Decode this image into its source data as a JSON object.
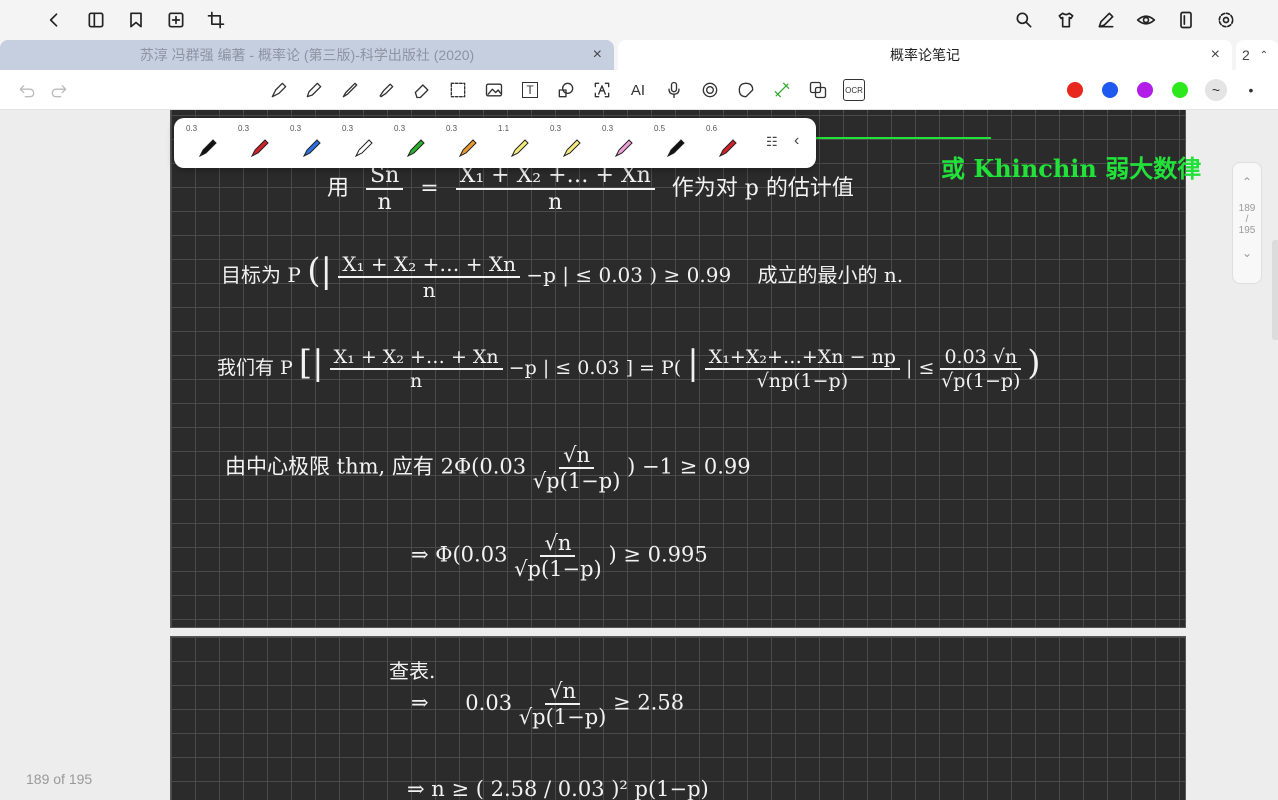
{
  "tabs": {
    "inactive_title": "苏淳 冯群强 编著 - 概率论 (第三版)-科学出版社 (2020)",
    "active_title": "概率论笔记",
    "close": "×",
    "count": "2"
  },
  "topbar_icons": [
    "back-icon",
    "sidebar-icon",
    "bookmark-icon",
    "add-page-icon",
    "crop-icon",
    "search-icon",
    "shirt-icon",
    "pen-edit-icon",
    "eye-icon",
    "page-layout-icon",
    "gear-icon"
  ],
  "toolbar": {
    "text_tool": "T",
    "ai_tool": "AI",
    "ocr_tool": "OCR",
    "more": "•",
    "colors": [
      "#e8281e",
      "#1e5af0",
      "#b21ee8",
      "#2ee81e"
    ]
  },
  "pen_presets": [
    {
      "size": "0.3",
      "color": "#111111"
    },
    {
      "size": "0.3",
      "color": "#d0202a"
    },
    {
      "size": "0.3",
      "color": "#2a6ee0"
    },
    {
      "size": "0.3",
      "color": "#ffffff"
    },
    {
      "size": "0.3",
      "color": "#2ab02a"
    },
    {
      "size": "0.3",
      "color": "#e89a30"
    },
    {
      "size": "1.1",
      "color": "#f3ea7c"
    },
    {
      "size": "0.3",
      "color": "#f3ea7c"
    },
    {
      "size": "0.3",
      "color": "#f0a0d8"
    },
    {
      "size": "0.5",
      "color": "#111111"
    },
    {
      "size": "0.6",
      "color": "#d0202a"
    }
  ],
  "scroller": {
    "current": "189",
    "sep": "/",
    "total": "195"
  },
  "status": "189 of 195",
  "notes": {
    "khinchin": "或 Khinchin 弱大数律",
    "use_prefix": "用",
    "sn": "Sn",
    "n": "n",
    "eq": "=",
    "sum_num": "X₁ + X₂ +… + Xn",
    "estimate": "作为对 p 的估计值",
    "goal_prefix": "目标为 P",
    "goal_tail": "−p | ≤ 0.03 ) ≥ 0.99",
    "goal_suffix": "成立的最小的 n.",
    "we_have": "我们有 P",
    "we_have_mid": "−p | ≤ 0.03 ] = P(",
    "std_num": "X₁+X₂+…+Xn − np",
    "std_den": "√np(1−p)",
    "le": "| ≤",
    "bound_num": "0.03 √n",
    "bound_den": "√p(1−p)",
    "close_paren": ")",
    "clt_line": "由中心极限 thm,  应有 2Φ(0.03",
    "clt_tail": ") −1 ≥ 0.99",
    "sqrt_n": "√n",
    "sqrt_p": "√p(1−p)",
    "phi_line": "⇒  Φ(0.03",
    "phi_tail": ") ≥ 0.995",
    "lookup": "查表.",
    "arrow": "⇒",
    "lookup_coef": "0.03",
    "lookup_tail": "≥ 2.58",
    "final_line": "⇒  n ≥  ( 2.58 / 0.03 )²  p(1−p)"
  }
}
